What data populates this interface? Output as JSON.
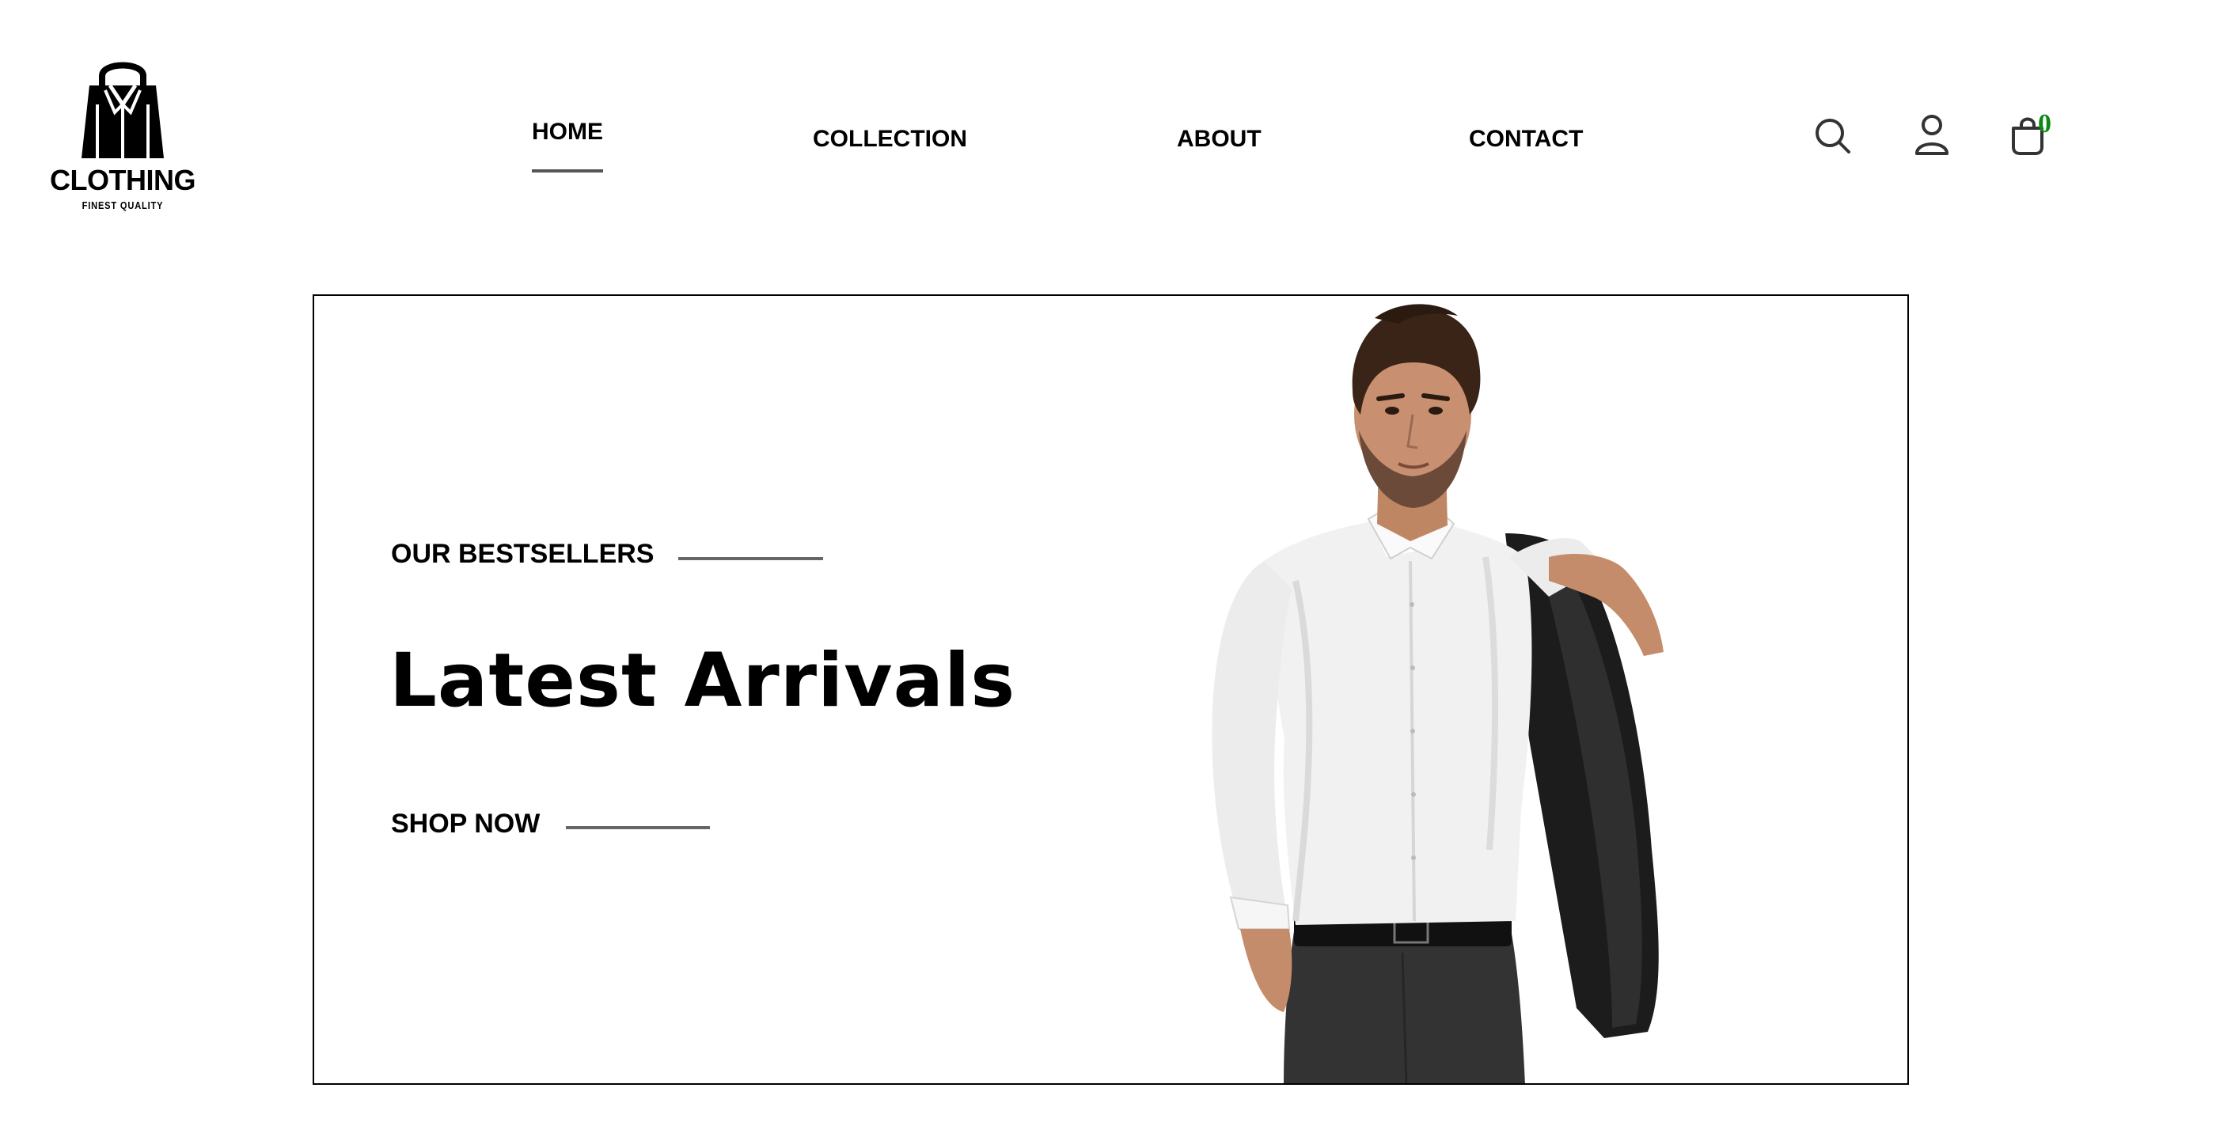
{
  "brand": {
    "name": "CLOTHING",
    "tagline": "FINEST QUALITY"
  },
  "nav": {
    "items": [
      {
        "label": "HOME",
        "active": true
      },
      {
        "label": "COLLECTION",
        "active": false
      },
      {
        "label": "ABOUT",
        "active": false
      },
      {
        "label": "CONTACT",
        "active": false
      }
    ]
  },
  "header_icons": [
    "search-icon",
    "user-icon",
    "shopping-bag-icon"
  ],
  "cart": {
    "count": "0",
    "count_color": "#0a8a12"
  },
  "hero": {
    "eyebrow": "OUR BESTSELLERS",
    "headline": "Latest Arrivals",
    "cta": "SHOP NOW",
    "image": "man-in-white-shirt-holding-jacket"
  }
}
